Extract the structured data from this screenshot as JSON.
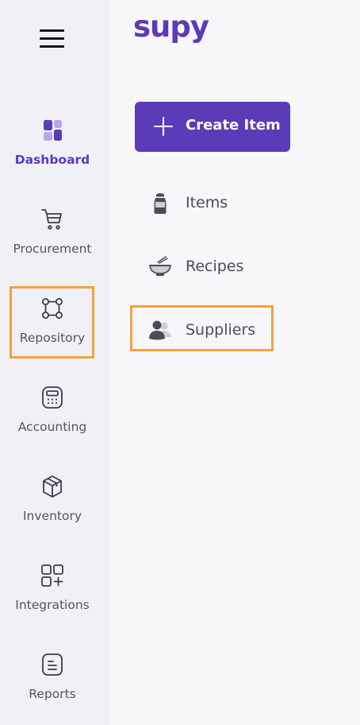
{
  "brand": {
    "logo_text": "supy"
  },
  "nav": {
    "items": [
      {
        "label": "Dashboard",
        "icon": "dashboard-icon",
        "active": true
      },
      {
        "label": "Procurement",
        "icon": "cart-icon"
      },
      {
        "label": "Repository",
        "icon": "repository-icon",
        "highlighted": true
      },
      {
        "label": "Accounting",
        "icon": "calculator-icon"
      },
      {
        "label": "Inventory",
        "icon": "box-icon"
      },
      {
        "label": "Integrations",
        "icon": "integrations-icon"
      },
      {
        "label": "Reports",
        "icon": "report-icon"
      }
    ]
  },
  "repository_menu": {
    "create_label": "Create Item",
    "items": [
      {
        "label": "Items",
        "icon": "salt-shaker-icon"
      },
      {
        "label": "Recipes",
        "icon": "bowl-icon"
      },
      {
        "label": "Suppliers",
        "icon": "users-icon",
        "highlighted": true
      }
    ]
  },
  "colors": {
    "accent": "#5b3bb8",
    "accent_light": "#b4a9e4",
    "highlight": "#f0a23e",
    "rail_bg": "#f1f0f7",
    "page_bg": "#f7f7fa"
  }
}
